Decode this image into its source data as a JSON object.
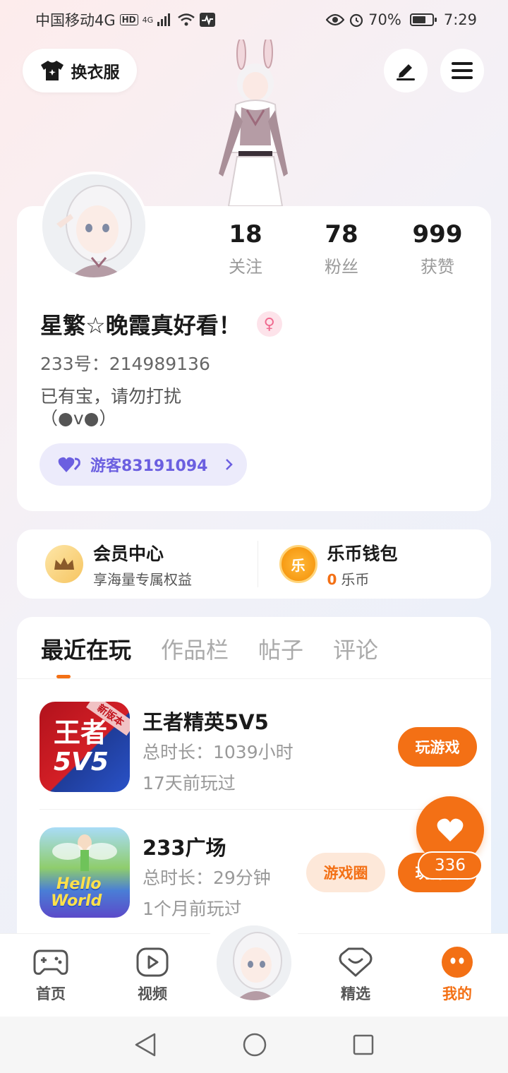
{
  "status_bar": {
    "carrier": "中国移动4G",
    "hd": "HD",
    "network": "4G",
    "battery": "70%",
    "battery_level": 0.7,
    "time": "7:29"
  },
  "header": {
    "outfit_label": "换衣服",
    "edit_icon": "pencil-icon",
    "menu_icon": "menu-icon"
  },
  "profile": {
    "stats": [
      {
        "value": "18",
        "label": "关注"
      },
      {
        "value": "78",
        "label": "粉丝"
      },
      {
        "value": "999",
        "label": "获赞"
      }
    ],
    "nickname": "星繁☆晚霞真好看！",
    "gender_symbol": "♀",
    "uid": "233号：214989136",
    "bio_line1": "已有宝，请勿打扰",
    "bio_line2": "（●v●）",
    "guest_label": "游客83191094"
  },
  "vip": {
    "member_title": "会员中心",
    "member_sub": "享海量专属权益",
    "wallet_title": "乐币钱包",
    "wallet_amount": "0",
    "wallet_unit": "乐币",
    "wallet_icon_char": "乐"
  },
  "tabs": [
    {
      "label": "最近在玩",
      "active": true
    },
    {
      "label": "作品栏",
      "active": false
    },
    {
      "label": "帖子",
      "active": false
    },
    {
      "label": "评论",
      "active": false
    }
  ],
  "games": [
    {
      "name": "王者精英5V5",
      "time": "总时长：1039小时",
      "last": "17天前玩过",
      "play_label": "玩游戏",
      "icon_text": "王者",
      "icon_text2": "5V5",
      "icon_badge": "新版本"
    },
    {
      "name": "233广场",
      "time": "总时长：29分钟",
      "last": "1个月前玩过",
      "circle_label": "游戏圈",
      "play_label": "玩游戏",
      "icon_text": "Hello",
      "icon_text2": "World"
    }
  ],
  "floating_like": {
    "count": "336"
  },
  "bottom_nav": [
    {
      "label": "首页",
      "icon": "gamepad-icon"
    },
    {
      "label": "视频",
      "icon": "play-icon"
    },
    {
      "label": "精选",
      "icon": "heart-chat-icon"
    },
    {
      "label": "我的",
      "icon": "face-icon"
    }
  ],
  "colors": {
    "accent": "#f37015",
    "guest": "#6b5fe0"
  }
}
